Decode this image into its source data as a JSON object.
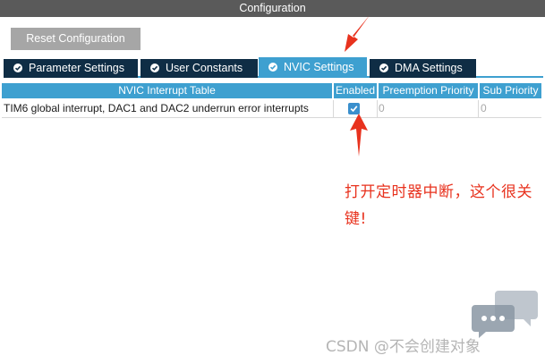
{
  "window": {
    "title": "Configuration"
  },
  "toolbar": {
    "reset_label": "Reset Configuration"
  },
  "tabs": [
    {
      "label": "Parameter Settings",
      "icon": "check-circle-icon",
      "active": false
    },
    {
      "label": "User Constants",
      "icon": "check-circle-icon",
      "active": false
    },
    {
      "label": "NVIC Settings",
      "icon": "check-circle-icon",
      "active": true
    },
    {
      "label": "DMA Settings",
      "icon": "check-circle-icon",
      "active": false
    }
  ],
  "table": {
    "columns": [
      "NVIC Interrupt Table",
      "Enabled",
      "Preemption Priority",
      "Sub Priority"
    ],
    "rows": [
      {
        "name": "TIM6 global interrupt, DAC1 and DAC2 underrun error interrupts",
        "enabled": true,
        "preemption": "0",
        "sub": "0"
      }
    ]
  },
  "annotation": {
    "text": "打开定时器中断，这个很关键!"
  },
  "watermark": {
    "text": "CSDN @不会创建对象"
  },
  "colors": {
    "titlebar": "#5a5a5a",
    "tab_dark": "#0f2d45",
    "tab_active": "#3ea0d0",
    "header": "#3ea0d0",
    "annotation": "#e8321e"
  }
}
